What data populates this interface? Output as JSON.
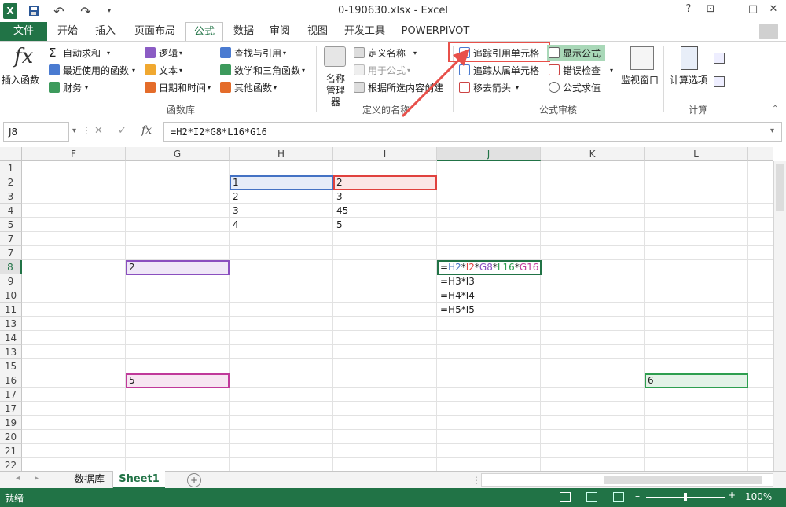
{
  "title": "0-190630.xlsx - Excel",
  "qat": {
    "app_icon": "X",
    "save_icon": "save-icon",
    "undo": "↶",
    "redo": "↷"
  },
  "window": {
    "help": "?",
    "restore_ribbon": "⊡",
    "minimize": "–",
    "maximize": "□",
    "close": "✕"
  },
  "tabs": [
    "文件",
    "开始",
    "插入",
    "页面布局",
    "公式",
    "数据",
    "审阅",
    "视图",
    "开发工具",
    "POWERPIVOT"
  ],
  "active_tab": "公式",
  "ribbon": {
    "insert_function": "插入函数",
    "fx_glyph": "fx",
    "function_library": {
      "items": [
        "自动求和",
        "最近使用的函数",
        "财务",
        "逻辑",
        "文本",
        "日期和时间",
        "查找与引用",
        "数学和三角函数",
        "其他函数"
      ],
      "group_label": "函数库"
    },
    "defined_names": {
      "name_manager": "名称\n管理器",
      "name_manager_l1": "名称",
      "name_manager_l2": "管理器",
      "define_name": "定义名称",
      "use_in_formula": "用于公式",
      "create_from_selection": "根据所选内容创建",
      "group_label": "定义的名称"
    },
    "auditing": {
      "trace_precedents": "追踪引用单元格",
      "trace_dependents": "追踪从属单元格",
      "remove_arrows": "移去箭头",
      "show_formulas": "显示公式",
      "error_checking": "错误检查",
      "evaluate_formula": "公式求值",
      "watch_window": "监视窗口",
      "group_label": "公式审核"
    },
    "calculation": {
      "options": "计算选项",
      "group_label": "计算"
    }
  },
  "formula_bar": {
    "name_box": "J8",
    "formula": "=H2*I2*G8*L16*G16",
    "cancel": "✕",
    "enter": "✓",
    "fx": "fx"
  },
  "columns": [
    "F",
    "G",
    "H",
    "I",
    "J",
    "K",
    "L"
  ],
  "selected_column": "J",
  "rows": [
    "1",
    "2",
    "3",
    "4",
    "5",
    "7",
    "8",
    "9",
    "10",
    "11",
    "13",
    "14",
    "15",
    "16",
    "17",
    "19",
    "20",
    "21",
    "22"
  ],
  "selected_row": "8",
  "cells": {
    "H2": "1",
    "I2": "2",
    "H3": "2",
    "I3": "3",
    "H4": "3",
    "I4": "45",
    "H5": "4",
    "I5": "5",
    "G8": "2",
    "G16": "5",
    "L16": "6",
    "J9": "=H3*I3",
    "J10": "=H4*I4",
    "J11": "=H5*I5"
  },
  "j8_formula_parts": [
    {
      "text": "=",
      "color": "#222222"
    },
    {
      "text": "H2",
      "color": "#4472c4"
    },
    {
      "text": "*",
      "color": "#222222"
    },
    {
      "text": "I2",
      "color": "#e0413e"
    },
    {
      "text": "*",
      "color": "#222222"
    },
    {
      "text": "G8",
      "color": "#8a4fbf"
    },
    {
      "text": "*",
      "color": "#222222"
    },
    {
      "text": "L16",
      "color": "#2e9e4f"
    },
    {
      "text": "*",
      "color": "#222222"
    },
    {
      "text": "G16",
      "color": "#c0399a"
    }
  ],
  "sheets": [
    "数据库",
    "Sheet1"
  ],
  "active_sheet": "Sheet1",
  "status": {
    "ready": "就绪",
    "zoom": "100%"
  },
  "colors": {
    "excel_green": "#217346",
    "trace_red": "#e8504a",
    "ref_blue": "#4472c4",
    "ref_red": "#e0413e",
    "ref_purple": "#8a4fbf",
    "ref_green": "#2e9e4f",
    "ref_magenta": "#c0399a"
  }
}
